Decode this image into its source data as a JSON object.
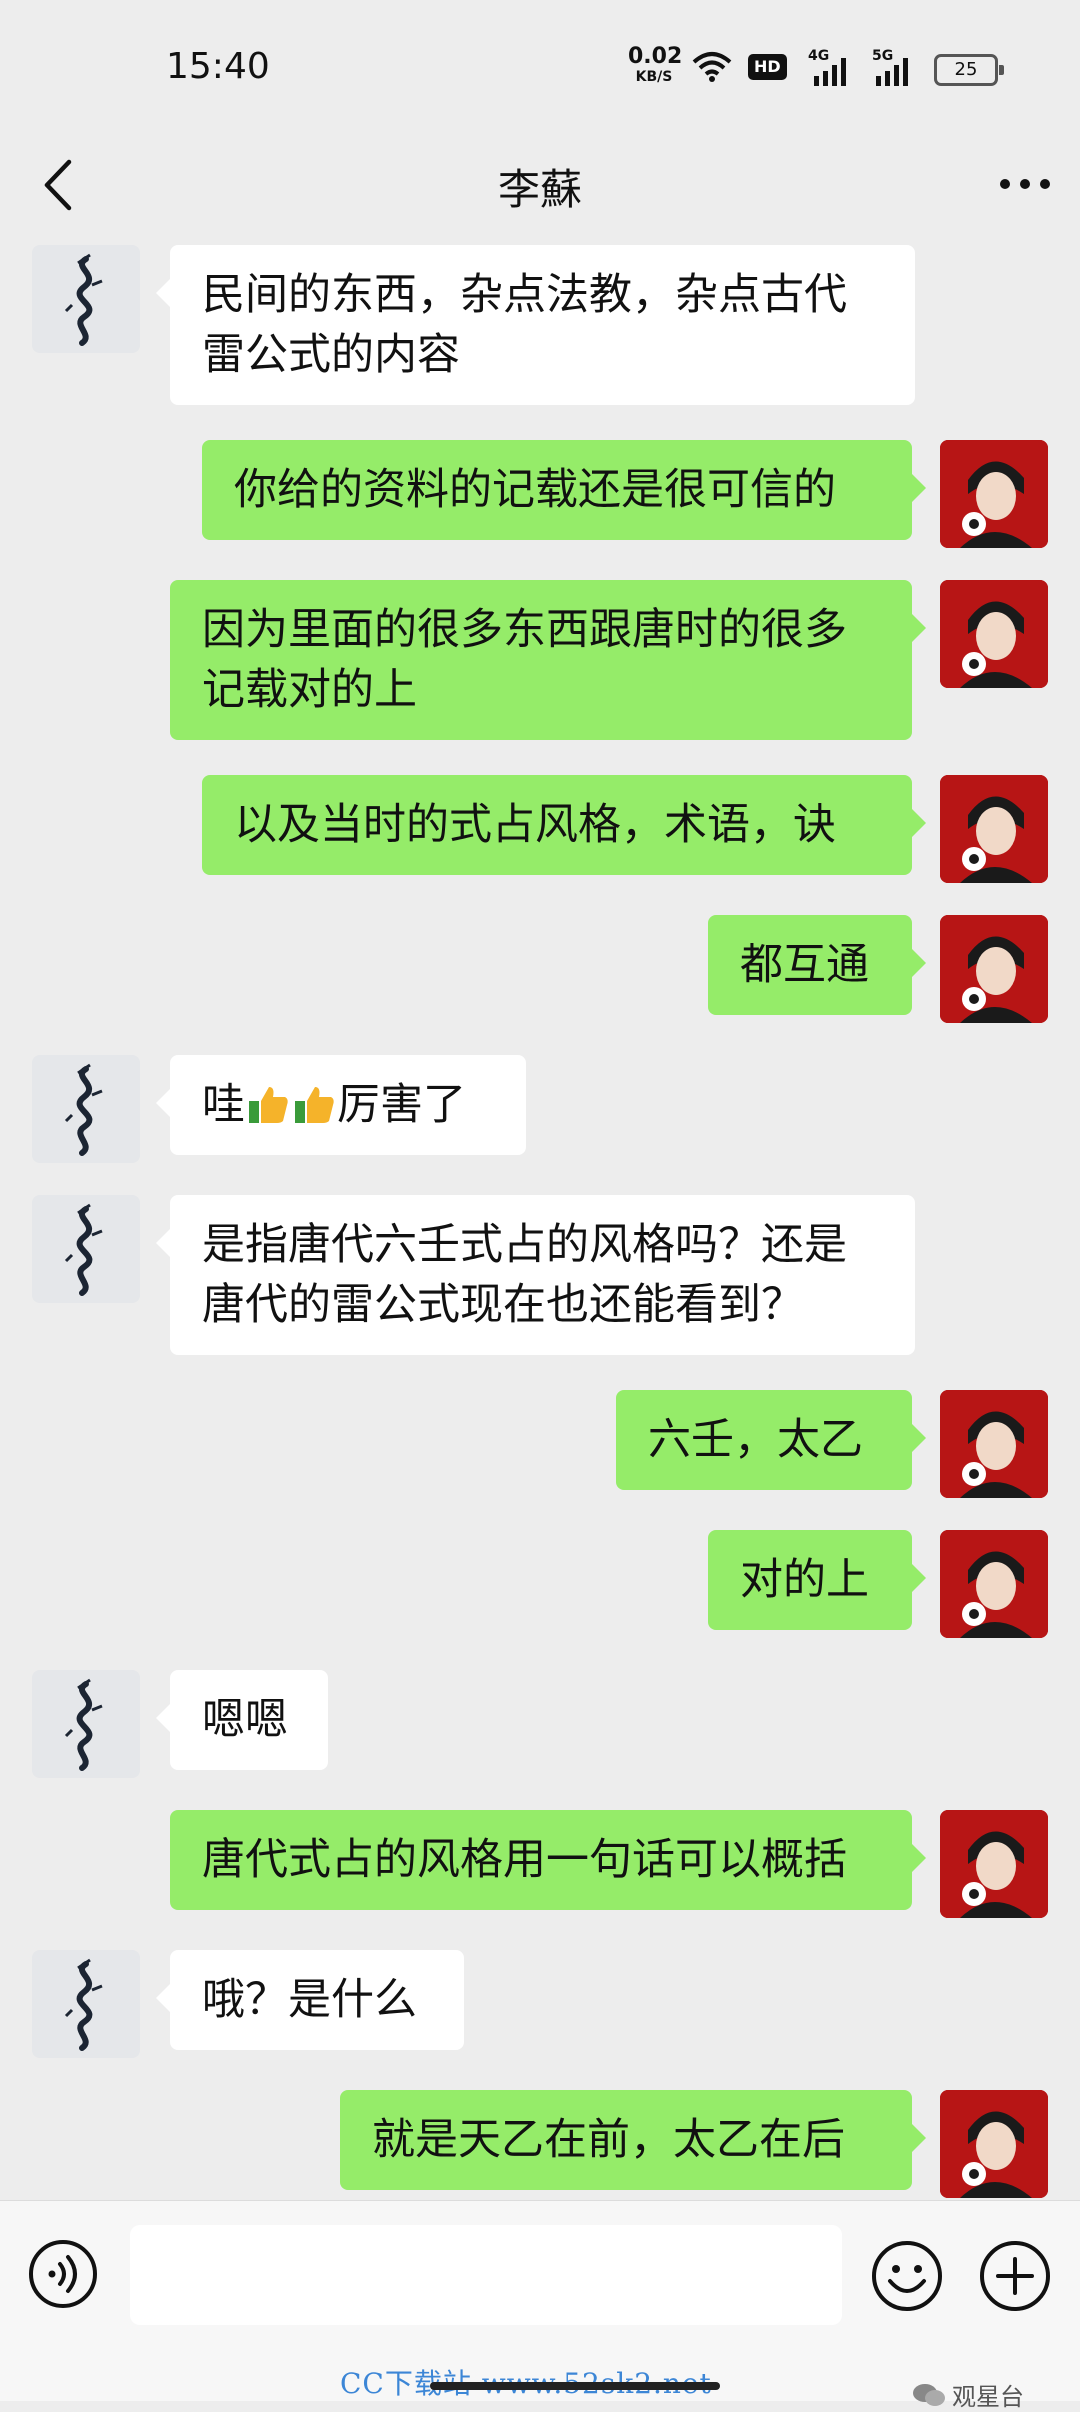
{
  "status_bar": {
    "time": "15:40",
    "net_speed_value": "0.02",
    "net_speed_unit": "KB/S",
    "hd_label": "HD",
    "sim1_label": "4G",
    "sim2_label": "5G",
    "battery": "25"
  },
  "header": {
    "title": "李蘇",
    "back_icon": "chevron-left-icon",
    "more_icon": "more-dots-icon"
  },
  "messages": [
    {
      "side": "in",
      "text": "民间的东西，杂点法教，杂点古代雷公式的内容"
    },
    {
      "side": "out",
      "text": "你给的资料的记载还是很可信的"
    },
    {
      "side": "out",
      "text": "因为里面的很多东西跟唐时的很多记载对的上"
    },
    {
      "side": "out",
      "text": "以及当时的式占风格，术语，诀"
    },
    {
      "side": "out",
      "text": "都互通"
    },
    {
      "side": "in",
      "text_before": "哇",
      "emoji_count": 2,
      "text_after": "厉害了"
    },
    {
      "side": "in",
      "text": "是指唐代六壬式占的风格吗？还是唐代的雷公式现在也还能看到？"
    },
    {
      "side": "out",
      "text": "六壬，太乙"
    },
    {
      "side": "out",
      "text": "对的上"
    },
    {
      "side": "in",
      "text": "嗯嗯"
    },
    {
      "side": "out",
      "text": "唐代式占的风格用一句话可以概括"
    },
    {
      "side": "in",
      "text": "哦？是什么"
    },
    {
      "side": "out",
      "text": "就是天乙在前，太乙在后"
    }
  ],
  "input_bar": {
    "placeholder": "",
    "voice_icon": "voice-icon",
    "emoji_icon": "emoji-icon",
    "plus_icon": "plus-icon"
  },
  "watermarks": {
    "brand": "观星台",
    "site": "CC下载站 www.52sk2.net"
  },
  "colors": {
    "background": "#ededed",
    "outgoing_bubble": "#95ec69",
    "incoming_bubble": "#ffffff",
    "watermark_link": "#3c86d6"
  }
}
